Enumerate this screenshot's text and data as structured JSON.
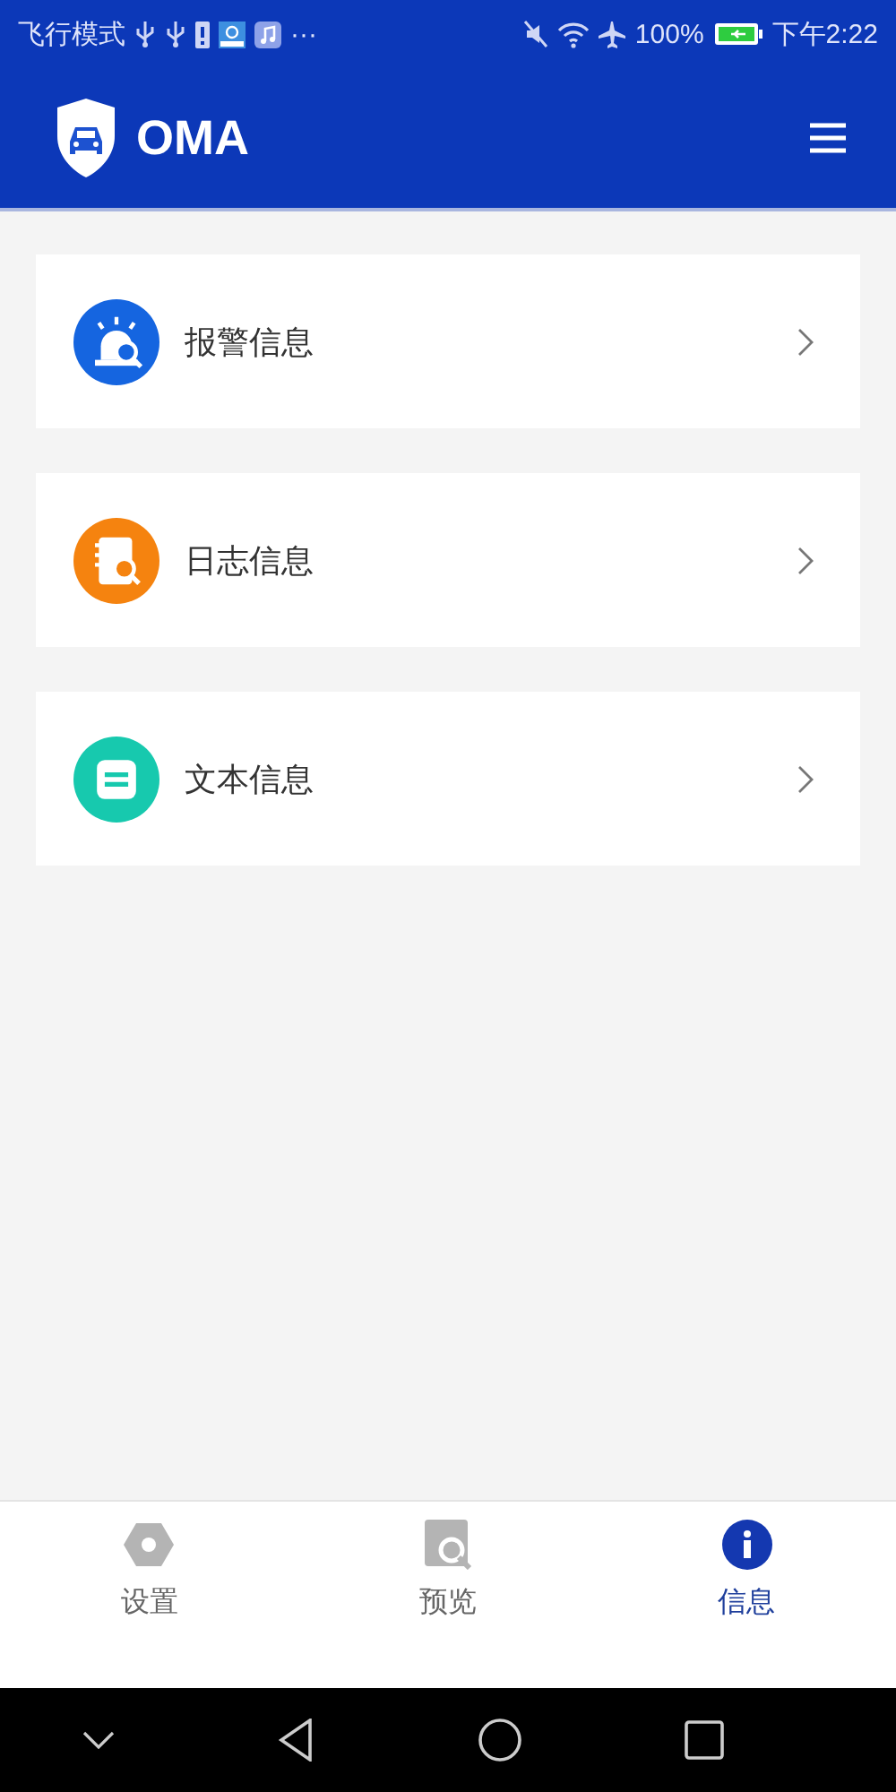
{
  "status_bar": {
    "mode": "飞行模式",
    "more": "···",
    "battery": "100%",
    "time": "下午2:22"
  },
  "app_bar": {
    "title": "OMA"
  },
  "items": [
    {
      "label": "报警信息",
      "kind": "alarm",
      "color": "#1565e0"
    },
    {
      "label": "日志信息",
      "kind": "log",
      "color": "#f5830f"
    },
    {
      "label": "文本信息",
      "kind": "text",
      "color": "#17c9ae"
    }
  ],
  "tabs": [
    {
      "label": "设置",
      "kind": "settings",
      "selected": false
    },
    {
      "label": "预览",
      "kind": "preview",
      "selected": false
    },
    {
      "label": "信息",
      "kind": "info",
      "selected": true
    }
  ]
}
